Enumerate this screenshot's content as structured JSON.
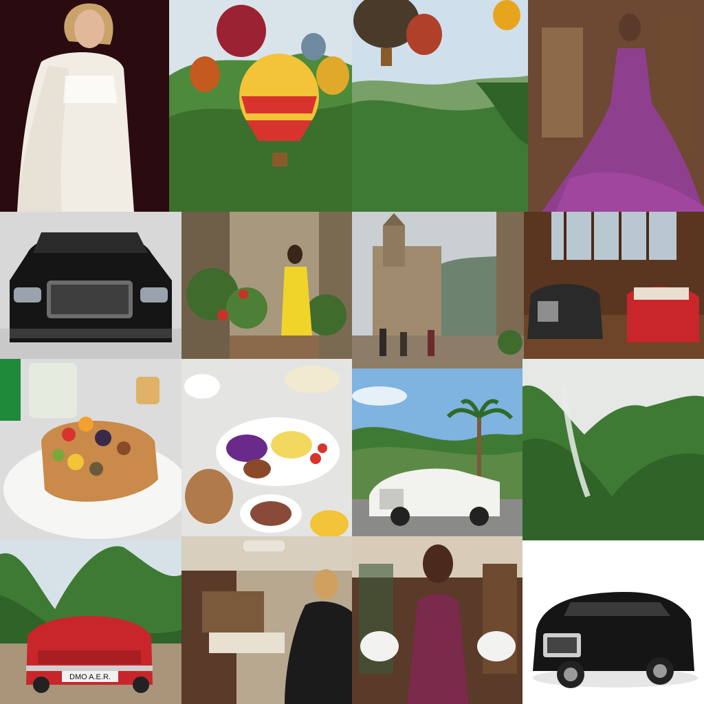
{
  "collage": {
    "grid": "4x4",
    "tiles": [
      {
        "subject": "woman-white-fur-gown"
      },
      {
        "subject": "hot-air-balloons-over-green-mountains"
      },
      {
        "subject": "hot-air-balloons-over-valley"
      },
      {
        "subject": "woman-purple-gown-ornate-room"
      },
      {
        "subject": "black-luxury-convertible-front"
      },
      {
        "subject": "woman-yellow-dress-among-plants"
      },
      {
        "subject": "old-town-church-misty-mountains"
      },
      {
        "subject": "vintage-cars-in-glass-hall"
      },
      {
        "subject": "fruit-on-toast-plate"
      },
      {
        "subject": "banquet-table-food-plates"
      },
      {
        "subject": "white-vintage-car-palm-tree"
      },
      {
        "subject": "waterfall-green-mountains"
      },
      {
        "subject": "red-convertible-mountain-road"
      },
      {
        "subject": "woman-resting-in-jet-interior"
      },
      {
        "subject": "woman-purple-dress-car-interior"
      },
      {
        "subject": "black-luxury-sedan-white-background"
      }
    ],
    "license_plate_text": "DMO A.E.R."
  },
  "colors": {
    "mountain_green": "#3f7a34",
    "sky_blue": "#7fb3e0",
    "gown_purple": "#8e3f8e",
    "car_red": "#c8262b",
    "car_black": "#151515",
    "balloon_yellow": "#f3c338"
  }
}
